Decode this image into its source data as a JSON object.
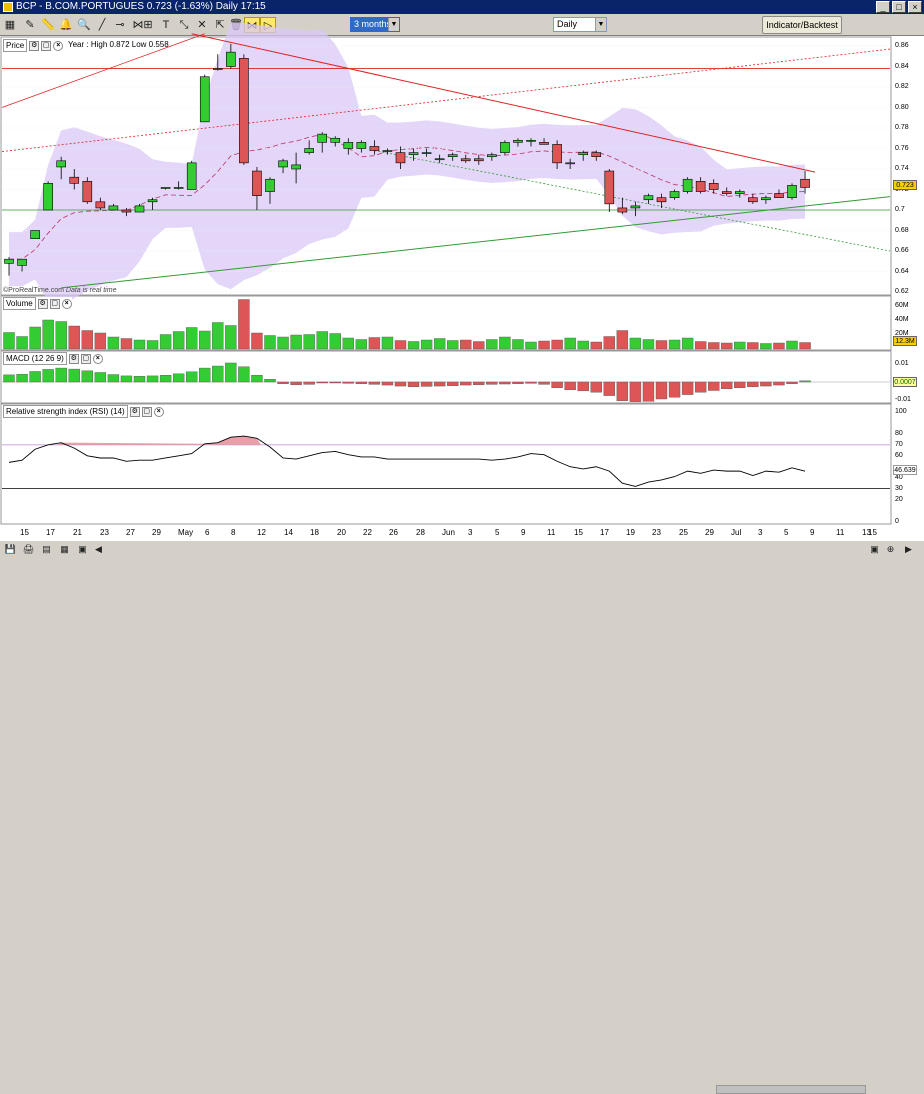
{
  "window": {
    "title": "BCP - B.COM.PORTUGUES   0.723 (-1.63%)   Daily 17:15"
  },
  "toolbar": {
    "period_select": "3 months",
    "interval_select": "Daily",
    "indicator_button": "Indicator/Backtest",
    "icons": [
      "drawing-icon",
      "pencil-icon",
      "ruler-icon",
      "bell-icon",
      "zoom-icon",
      "trendline-icon",
      "channel-icon",
      "hline-icon",
      "fibonacci-icon",
      "text-icon",
      "arrow-tool-icon",
      "cross-icon",
      "cursor-icon",
      "delete-icon",
      "magnet-icon",
      "fan-icon"
    ]
  },
  "price_panel": {
    "title": "Price",
    "info": "Year : High 0.872 Low 0.558",
    "watermark": "ProRealTime.com",
    "watermark_note": "Data is real time",
    "y_ticks": [
      "0.86",
      "0.84",
      "0.82",
      "0.80",
      "0.78",
      "0.76",
      "0.74",
      "0.72",
      "0.7",
      "0.68",
      "0.66",
      "0.64",
      "0.62"
    ],
    "last_value": "0.723",
    "badge_color": "#ffcc00"
  },
  "volume_panel": {
    "title": "Volume",
    "y_ticks": [
      "60M",
      "40M",
      "20M"
    ],
    "last_value": "12.3M"
  },
  "macd_panel": {
    "title": "MACD (12 26 9)",
    "y_ticks": [
      "0.01",
      "0.00",
      "-0.01"
    ],
    "last_value": "0.0007"
  },
  "rsi_panel": {
    "title": "Relative strength index (RSI) (14)",
    "y_ticks": [
      "100",
      "80",
      "70",
      "60",
      "40",
      "30",
      "20",
      "0"
    ],
    "last_value": "46.639"
  },
  "x_dates": [
    "15",
    "17",
    "21",
    "23",
    "27",
    "29",
    "May",
    "6",
    "8",
    "12",
    "14",
    "18",
    "20",
    "22",
    "26",
    "28",
    "Jun",
    "3",
    "5",
    "9",
    "11",
    "15",
    "17",
    "19",
    "23",
    "25",
    "29",
    "Jul",
    "3",
    "5",
    "9",
    "11",
    "13",
    "15"
  ],
  "colors": {
    "up": "#33cc33",
    "down": "#dd5555",
    "band": "#d9c8f5",
    "trend_red": "#dd2222",
    "trend_green": "#339933"
  },
  "chart_data": {
    "type": "candlestick",
    "ohlc": [
      [
        0.648,
        0.654,
        0.636,
        0.652
      ],
      [
        0.646,
        0.652,
        0.64,
        0.652
      ],
      [
        0.672,
        0.68,
        0.672,
        0.68
      ],
      [
        0.7,
        0.728,
        0.7,
        0.726
      ],
      [
        0.742,
        0.752,
        0.73,
        0.748
      ],
      [
        0.732,
        0.74,
        0.72,
        0.726
      ],
      [
        0.728,
        0.732,
        0.706,
        0.708
      ],
      [
        0.708,
        0.712,
        0.7,
        0.702
      ],
      [
        0.7,
        0.706,
        0.7,
        0.704
      ],
      [
        0.7,
        0.702,
        0.694,
        0.698
      ],
      [
        0.698,
        0.706,
        0.698,
        0.704
      ],
      [
        0.708,
        0.712,
        0.7,
        0.71
      ],
      [
        0.722,
        0.722,
        0.72,
        0.722
      ],
      [
        0.722,
        0.728,
        0.72,
        0.722
      ],
      [
        0.72,
        0.748,
        0.72,
        0.746
      ],
      [
        0.786,
        0.832,
        0.786,
        0.83
      ],
      [
        0.838,
        0.852,
        0.836,
        0.838
      ],
      [
        0.84,
        0.862,
        0.838,
        0.854
      ],
      [
        0.848,
        0.852,
        0.744,
        0.746
      ],
      [
        0.738,
        0.742,
        0.7,
        0.714
      ],
      [
        0.718,
        0.732,
        0.706,
        0.73
      ],
      [
        0.742,
        0.75,
        0.736,
        0.748
      ],
      [
        0.74,
        0.756,
        0.726,
        0.744
      ],
      [
        0.756,
        0.768,
        0.754,
        0.76
      ],
      [
        0.766,
        0.776,
        0.756,
        0.774
      ],
      [
        0.766,
        0.772,
        0.762,
        0.77
      ],
      [
        0.76,
        0.77,
        0.754,
        0.766
      ],
      [
        0.76,
        0.768,
        0.756,
        0.766
      ],
      [
        0.762,
        0.768,
        0.754,
        0.758
      ],
      [
        0.758,
        0.76,
        0.754,
        0.758
      ],
      [
        0.756,
        0.762,
        0.74,
        0.746
      ],
      [
        0.754,
        0.76,
        0.748,
        0.756
      ],
      [
        0.756,
        0.76,
        0.752,
        0.756
      ],
      [
        0.75,
        0.754,
        0.746,
        0.75
      ],
      [
        0.752,
        0.756,
        0.748,
        0.754
      ],
      [
        0.75,
        0.754,
        0.746,
        0.748
      ],
      [
        0.75,
        0.754,
        0.744,
        0.748
      ],
      [
        0.752,
        0.756,
        0.748,
        0.754
      ],
      [
        0.756,
        0.768,
        0.754,
        0.766
      ],
      [
        0.766,
        0.77,
        0.762,
        0.768
      ],
      [
        0.768,
        0.77,
        0.762,
        0.768
      ],
      [
        0.766,
        0.77,
        0.764,
        0.764
      ],
      [
        0.764,
        0.768,
        0.74,
        0.746
      ],
      [
        0.746,
        0.75,
        0.74,
        0.746
      ],
      [
        0.754,
        0.758,
        0.748,
        0.756
      ],
      [
        0.756,
        0.758,
        0.748,
        0.752
      ],
      [
        0.738,
        0.74,
        0.698,
        0.706
      ],
      [
        0.702,
        0.712,
        0.696,
        0.698
      ],
      [
        0.702,
        0.708,
        0.694,
        0.704
      ],
      [
        0.71,
        0.716,
        0.706,
        0.714
      ],
      [
        0.712,
        0.716,
        0.702,
        0.708
      ],
      [
        0.712,
        0.72,
        0.71,
        0.718
      ],
      [
        0.718,
        0.732,
        0.716,
        0.73
      ],
      [
        0.728,
        0.732,
        0.716,
        0.718
      ],
      [
        0.726,
        0.73,
        0.716,
        0.72
      ],
      [
        0.718,
        0.722,
        0.714,
        0.716
      ],
      [
        0.716,
        0.72,
        0.712,
        0.718
      ],
      [
        0.712,
        0.716,
        0.706,
        0.708
      ],
      [
        0.71,
        0.714,
        0.706,
        0.712
      ],
      [
        0.716,
        0.72,
        0.712,
        0.712
      ],
      [
        0.712,
        0.726,
        0.71,
        0.724
      ],
      [
        0.73,
        0.738,
        0.716,
        0.722
      ]
    ],
    "volume_rel": [
      0.33,
      0.25,
      0.44,
      0.58,
      0.55,
      0.46,
      0.37,
      0.32,
      0.24,
      0.21,
      0.18,
      0.17,
      0.29,
      0.35,
      0.43,
      0.36,
      0.53,
      0.47,
      0.99,
      0.32,
      0.27,
      0.24,
      0.28,
      0.29,
      0.35,
      0.31,
      0.22,
      0.19,
      0.23,
      0.24,
      0.17,
      0.15,
      0.18,
      0.21,
      0.17,
      0.18,
      0.15,
      0.19,
      0.24,
      0.19,
      0.14,
      0.16,
      0.18,
      0.22,
      0.16,
      0.14,
      0.25,
      0.37,
      0.22,
      0.19,
      0.17,
      0.18,
      0.22,
      0.15,
      0.13,
      0.12,
      0.14,
      0.13,
      0.11,
      0.12,
      0.16,
      0.13
    ],
    "macd": [
      0.0042,
      0.0046,
      0.0062,
      0.0074,
      0.0082,
      0.0076,
      0.0066,
      0.0056,
      0.0044,
      0.0036,
      0.0034,
      0.0036,
      0.004,
      0.0048,
      0.006,
      0.0082,
      0.0094,
      0.0112,
      0.009,
      0.004,
      0.0016,
      -0.001,
      -0.0016,
      -0.0014,
      -0.0004,
      -0.0002,
      -0.0008,
      -0.001,
      -0.0014,
      -0.0018,
      -0.0024,
      -0.0028,
      -0.0026,
      -0.0024,
      -0.0022,
      -0.0018,
      -0.0016,
      -0.0014,
      -0.0012,
      -0.001,
      -0.0008,
      -0.0014,
      -0.0034,
      -0.0046,
      -0.0052,
      -0.006,
      -0.008,
      -0.011,
      -0.0116,
      -0.0114,
      -0.01,
      -0.009,
      -0.0074,
      -0.006,
      -0.005,
      -0.004,
      -0.0034,
      -0.0028,
      -0.0024,
      -0.0018,
      -0.001,
      0.0007
    ],
    "rsi": [
      54,
      56,
      66,
      70,
      72,
      67,
      60,
      58,
      58,
      55,
      56,
      56,
      58,
      60,
      62,
      71,
      72,
      77,
      78,
      76,
      68,
      58,
      57,
      60,
      63,
      64,
      61,
      59,
      59,
      57,
      57,
      57,
      57,
      57,
      57,
      57,
      57,
      56,
      57,
      59,
      62,
      61,
      55,
      50,
      48,
      50,
      46,
      35,
      32,
      36,
      38,
      41,
      46,
      44,
      47,
      46,
      46,
      42,
      46,
      45,
      49,
      46
    ]
  }
}
